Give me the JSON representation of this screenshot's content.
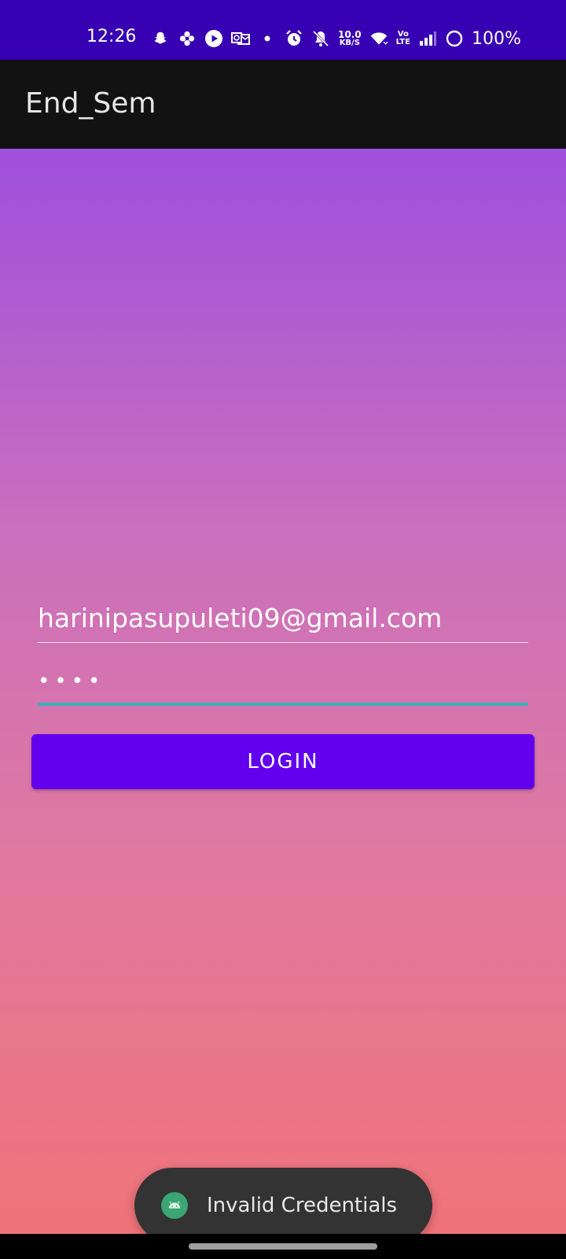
{
  "status_bar": {
    "time": "12:26",
    "data_speed_value": "10.0",
    "data_speed_unit": "KB/S",
    "volte_top": "Vo",
    "volte_bottom": "LTE",
    "battery": "100%",
    "icons": [
      "snapchat-icon",
      "flower-icon",
      "play-icon",
      "outlook-icon",
      "dot-icon",
      "alarm-icon",
      "mute-icon",
      "wifi-icon",
      "signal-icon",
      "battery-icon"
    ]
  },
  "app_bar": {
    "title": "End_Sem"
  },
  "login_form": {
    "email_value": "harinipasupuleti09@gmail.com",
    "password_masked": "••••",
    "login_label": "LOGIN"
  },
  "toast": {
    "message": "Invalid Credentials"
  },
  "colors": {
    "status_bar": "#3700b3",
    "app_bar": "#121212",
    "button": "#6200ee",
    "focus_underline": "#3ab2b8",
    "gradient_top": "#9f4fdd",
    "gradient_bottom": "#f07379"
  }
}
